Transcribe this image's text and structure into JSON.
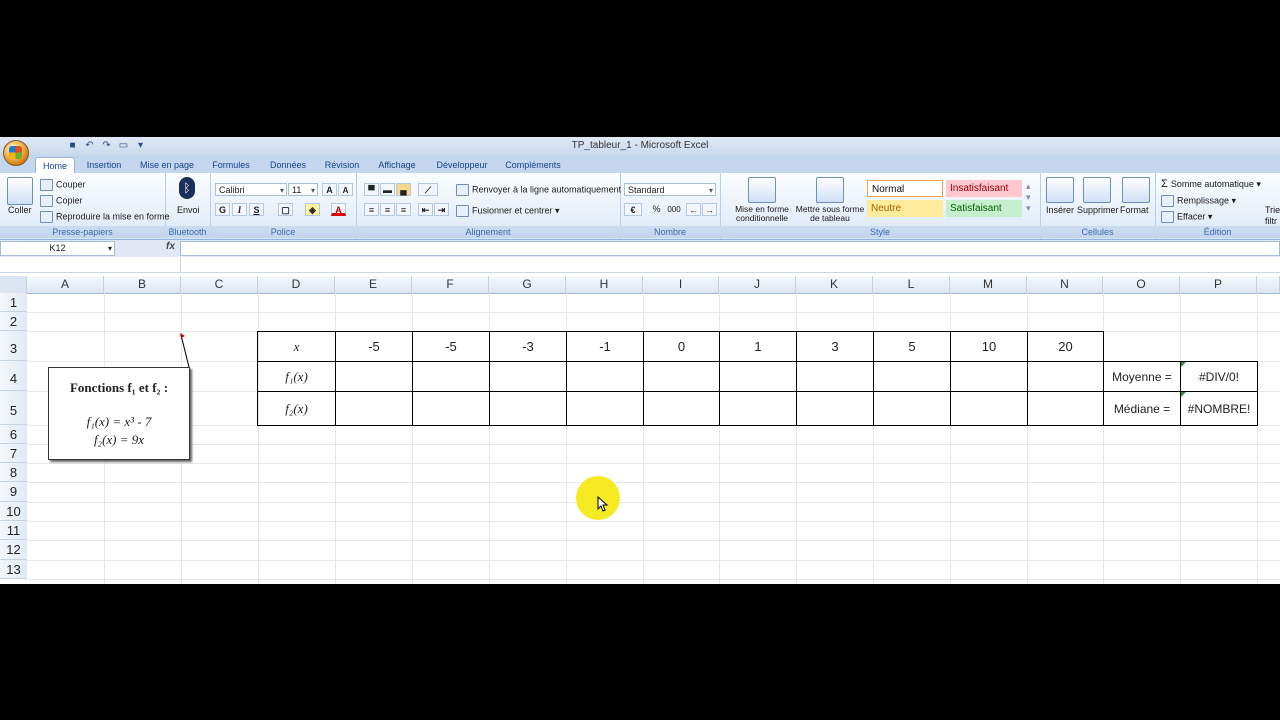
{
  "window": {
    "title": "TP_tableur_1 - Microsoft Excel"
  },
  "tabs": [
    "Home",
    "Insertion",
    "Mise en page",
    "Formules",
    "Données",
    "Révision",
    "Affichage",
    "Développeur",
    "Compléments"
  ],
  "ribbon": {
    "clipboard": {
      "label": "Presse-papiers",
      "paste": "Coller",
      "cut": "Couper",
      "copy": "Copier",
      "format_painter": "Reproduire la mise en forme"
    },
    "bluetooth": {
      "label": "Bluetooth",
      "send": "Envoi"
    },
    "font": {
      "label": "Police",
      "name": "Calibri",
      "size": "11",
      "bold": "G",
      "italic": "I",
      "underline": "S"
    },
    "alignment": {
      "label": "Alignement",
      "wrap": "Renvoyer à la ligne automatiquement",
      "merge": "Fusionner et centrer"
    },
    "number": {
      "label": "Nombre",
      "format": "Standard",
      "percent": "%",
      "thousands": "000"
    },
    "style": {
      "label": "Style",
      "conditional": "Mise en forme conditionnelle",
      "table": "Mettre sous forme de tableau",
      "normal": "Normal",
      "bad": "Insatisfaisant",
      "neutral": "Neutre",
      "good": "Satisfaisant"
    },
    "cells": {
      "label": "Cellules",
      "insert": "Insérer",
      "delete": "Supprimer",
      "format": "Format"
    },
    "editing": {
      "label": "Édition",
      "autosum": "Somme automatique",
      "fill": "Remplissage",
      "clear": "Effacer",
      "sort": "Trier",
      "filter": "filtr"
    }
  },
  "formula_bar": {
    "name_box": "K12",
    "fx": "fx",
    "formula": ""
  },
  "columns": [
    "A",
    "B",
    "C",
    "D",
    "E",
    "F",
    "G",
    "H",
    "I",
    "J",
    "K",
    "L",
    "M",
    "N",
    "O",
    "P"
  ],
  "rows": [
    "1",
    "2",
    "3",
    "4",
    "5",
    "6",
    "7",
    "8",
    "9",
    "10",
    "11",
    "12",
    "13"
  ],
  "table": {
    "x_label": "x",
    "f1_label": "f₁(x)",
    "f2_label": "f₂(x)",
    "x_values": [
      "-5",
      "-5",
      "-3",
      "-1",
      "0",
      "1",
      "3",
      "5",
      "10",
      "20"
    ]
  },
  "stats": {
    "mean_label": "Moyenne =",
    "mean_value": "#DIV/0!",
    "median_label": "Médiane =",
    "median_value": "#NOMBRE!"
  },
  "textbox": {
    "title": "Fonctions f₁ et f₂ :",
    "line1": "f₁(x) = x³ - 7",
    "line2": "f₂(x) = 9x"
  }
}
